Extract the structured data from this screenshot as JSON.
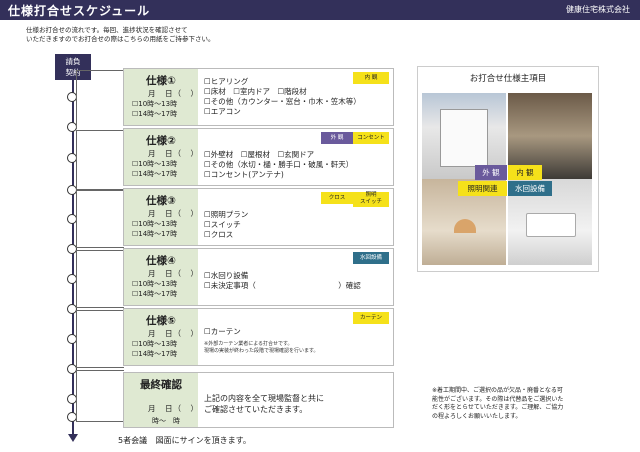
{
  "header": {
    "title": "仕様打合せスケジュール",
    "company": "健康住宅株式会社"
  },
  "intro": {
    "line1": "仕様お打合せの流れです。毎回、進捗状況を確認させて",
    "line2": "いただきますのでお打合せの際はこちらの用紙をご持参下さい。"
  },
  "start": {
    "line1": "請負",
    "line2": "契約"
  },
  "cards": [
    {
      "title": "仕様①",
      "date": "月　日（　）",
      "time1": "☐10時～13時",
      "time2": "☐14時～17時",
      "items": [
        "☐ヒアリング",
        "☐床材　☐室内ドア　☐階段材",
        "☐その他（カウンター・窓台・巾木・笠木等）",
        "☐エアコン"
      ],
      "tags": [
        "内 観"
      ]
    },
    {
      "title": "仕様②",
      "date": "月　日（　）",
      "time1": "☐10時～13時",
      "time2": "☐14時～17時",
      "items": [
        "☐外壁材　☐屋根材　☐玄関ドア",
        "☐その他（水切・樋・勝手口・破風・軒天）",
        "☐コンセント(アンテナ)"
      ],
      "tags": [
        "外 観",
        "コンセント"
      ]
    },
    {
      "title": "仕様③",
      "date": "月　日（　）",
      "time1": "☐10時～13時",
      "time2": "☐14時～17時",
      "items": [
        "☐照明プラン",
        "☐スイッチ",
        "☐クロス"
      ],
      "tags": [
        "クロス",
        "照明",
        "スイッチ"
      ]
    },
    {
      "title": "仕様④",
      "date": "月　日（　）",
      "time1": "☐10時～13時",
      "time2": "☐14時～17時",
      "items": [
        "☐水回り設備",
        "☐未決定事項（　　　　　　　　　　　）確認"
      ],
      "tags": [
        "水回設備"
      ]
    },
    {
      "title": "仕様⑤",
      "date": "月　日（　）",
      "time1": "☐10時～13時",
      "time2": "☐14時～17時",
      "items": [
        "☐カーテン"
      ],
      "note1": "※外部カーテン業者による打合せです。",
      "note2": "現場の実装が終わった段階で現場確認を行います。",
      "tags": [
        "カーテン"
      ]
    }
  ],
  "final": {
    "title": "最終確認",
    "date": "月　日（　）",
    "time": "時～　時",
    "line1": "上記の内容を全て現場監督と共に",
    "line2": "ご確認させていただきます。"
  },
  "bottom": {
    "label": "5者会議",
    "text": "図面にサインを頂きます。"
  },
  "photos": {
    "title": "お打合せ仕様主項目",
    "labels": [
      "外 観",
      "内 観",
      "照明関連",
      "水回設備"
    ]
  },
  "disclaimer": [
    "※着工期間中、ご選択の品が欠品・廃番となる可",
    "能性がございます。その際は代替品をご選択いた",
    "だく形をとらせていただきます。ご理解、ご協力",
    "の程よろしくお願いいたします。"
  ],
  "colors": {
    "navy": "#33305a",
    "green": "#dfe9d2",
    "yellow": "#f5e11a",
    "purple": "#6a5a9c",
    "teal": "#2f6f8a"
  }
}
